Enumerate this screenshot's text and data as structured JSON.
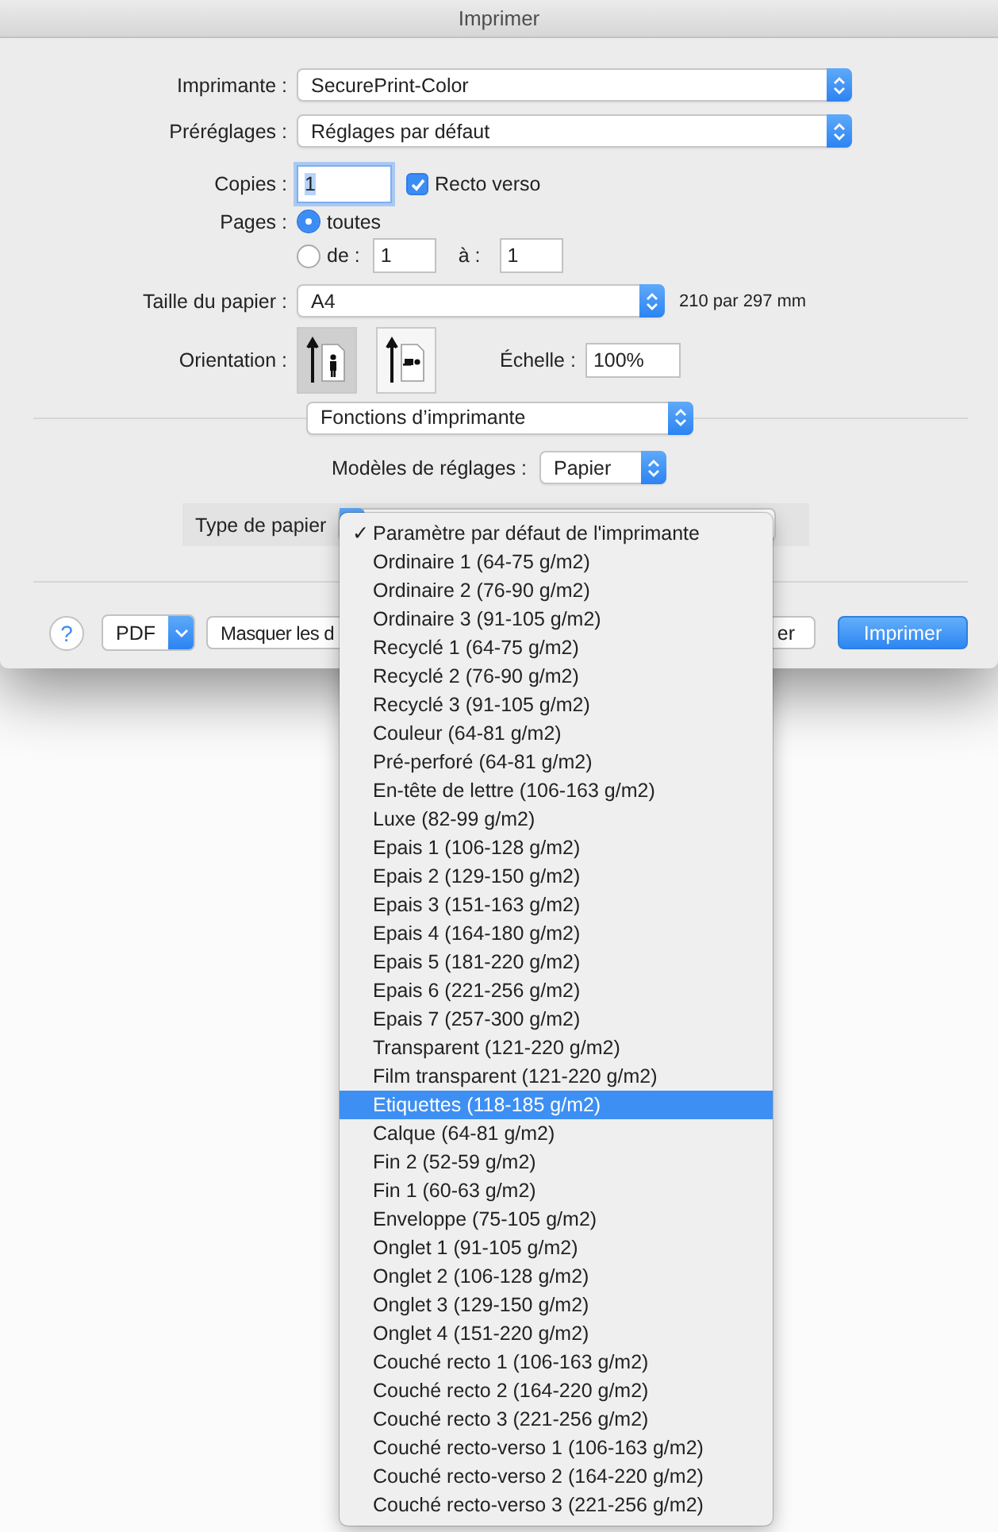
{
  "window": {
    "title": "Imprimer"
  },
  "printer": {
    "label": "Imprimante :",
    "value": "SecurePrint-Color"
  },
  "presets": {
    "label": "Préréglages :",
    "value": "Réglages par défaut"
  },
  "copies": {
    "label": "Copies :",
    "value": "1"
  },
  "duplex": {
    "label": "Recto verso",
    "checked": true
  },
  "pages": {
    "label": "Pages :",
    "options": [
      {
        "label": "toutes",
        "selected": true
      },
      {
        "label": "de :",
        "selected": false
      }
    ],
    "from": "1",
    "to_label": "à :",
    "to": "1"
  },
  "paper_size": {
    "label": "Taille du papier :",
    "value": "A4",
    "dimensions": "210 par 297 mm"
  },
  "orientation": {
    "label": "Orientation :",
    "options": [
      {
        "kind": "portrait",
        "selected": true
      },
      {
        "kind": "landscape",
        "selected": false
      }
    ]
  },
  "scale": {
    "label": "Échelle :",
    "value": "100%"
  },
  "section": {
    "value": "Fonctions d’imprimante"
  },
  "settings_model": {
    "label": "Modèles de réglages :",
    "value": "Papier"
  },
  "paper_type": {
    "label": "Type de papier"
  },
  "menu_check": "✓",
  "menu": [
    {
      "label": "Paramètre par défaut de l'imprimante",
      "checked": true,
      "selected": false
    },
    {
      "label": "Ordinaire 1 (64-75 g/m2)",
      "checked": false,
      "selected": false
    },
    {
      "label": "Ordinaire 2 (76-90 g/m2)",
      "checked": false,
      "selected": false
    },
    {
      "label": "Ordinaire 3 (91-105 g/m2)",
      "checked": false,
      "selected": false
    },
    {
      "label": "Recyclé 1 (64-75 g/m2)",
      "checked": false,
      "selected": false
    },
    {
      "label": "Recyclé 2 (76-90 g/m2)",
      "checked": false,
      "selected": false
    },
    {
      "label": "Recyclé 3 (91-105 g/m2)",
      "checked": false,
      "selected": false
    },
    {
      "label": "Couleur (64-81 g/m2)",
      "checked": false,
      "selected": false
    },
    {
      "label": "Pré-perforé (64-81 g/m2)",
      "checked": false,
      "selected": false
    },
    {
      "label": "En-tête de lettre (106-163 g/m2)",
      "checked": false,
      "selected": false
    },
    {
      "label": "Luxe (82-99 g/m2)",
      "checked": false,
      "selected": false
    },
    {
      "label": "Epais 1 (106-128 g/m2)",
      "checked": false,
      "selected": false
    },
    {
      "label": "Epais 2 (129-150 g/m2)",
      "checked": false,
      "selected": false
    },
    {
      "label": "Epais 3 (151-163 g/m2)",
      "checked": false,
      "selected": false
    },
    {
      "label": "Epais 4 (164-180 g/m2)",
      "checked": false,
      "selected": false
    },
    {
      "label": "Epais 5 (181-220 g/m2)",
      "checked": false,
      "selected": false
    },
    {
      "label": "Epais 6 (221-256 g/m2)",
      "checked": false,
      "selected": false
    },
    {
      "label": "Epais 7 (257-300 g/m2)",
      "checked": false,
      "selected": false
    },
    {
      "label": "Transparent (121-220 g/m2)",
      "checked": false,
      "selected": false
    },
    {
      "label": "Film transparent (121-220 g/m2)",
      "checked": false,
      "selected": false
    },
    {
      "label": "Etiquettes (118-185 g/m2)",
      "checked": false,
      "selected": true
    },
    {
      "label": "Calque (64-81 g/m2)",
      "checked": false,
      "selected": false
    },
    {
      "label": "Fin 2 (52-59 g/m2)",
      "checked": false,
      "selected": false
    },
    {
      "label": "Fin 1 (60-63 g/m2)",
      "checked": false,
      "selected": false
    },
    {
      "label": "Enveloppe (75-105 g/m2)",
      "checked": false,
      "selected": false
    },
    {
      "label": "Onglet 1 (91-105 g/m2)",
      "checked": false,
      "selected": false
    },
    {
      "label": "Onglet 2 (106-128 g/m2)",
      "checked": false,
      "selected": false
    },
    {
      "label": "Onglet 3 (129-150 g/m2)",
      "checked": false,
      "selected": false
    },
    {
      "label": "Onglet 4 (151-220 g/m2)",
      "checked": false,
      "selected": false
    },
    {
      "label": "Couché recto 1 (106-163 g/m2)",
      "checked": false,
      "selected": false
    },
    {
      "label": "Couché recto 2 (164-220 g/m2)",
      "checked": false,
      "selected": false
    },
    {
      "label": "Couché recto 3 (221-256 g/m2)",
      "checked": false,
      "selected": false
    },
    {
      "label": "Couché recto-verso 1 (106-163 g/m2)",
      "checked": false,
      "selected": false
    },
    {
      "label": "Couché recto-verso 2 (164-220 g/m2)",
      "checked": false,
      "selected": false
    },
    {
      "label": "Couché recto-verso 3 (221-256 g/m2)",
      "checked": false,
      "selected": false
    }
  ],
  "buttons": {
    "help": "?",
    "pdf": "PDF",
    "details": "Masquer les d",
    "cancel": "er",
    "print": "Imprimer"
  }
}
